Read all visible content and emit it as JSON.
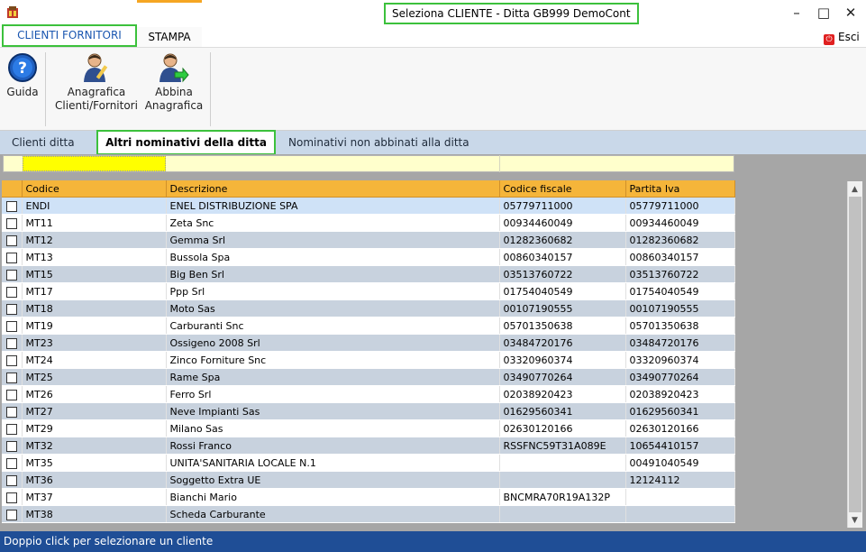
{
  "window": {
    "title": "Seleziona CLIENTE  - Ditta GB999 DemoCont",
    "minimize": "–",
    "maximize": "□",
    "close": "✕"
  },
  "ribbon": {
    "tabs": [
      {
        "label": "CLIENTI FORNITORI",
        "active": true
      },
      {
        "label": "STAMPA",
        "active": false
      }
    ],
    "exit_label": "Esci"
  },
  "toolbar": {
    "guida_label": "Guida",
    "anagrafica_line1": "Anagrafica",
    "anagrafica_line2": "Clienti/Fornitori",
    "abbina_line1": "Abbina",
    "abbina_line2": "Anagrafica"
  },
  "subtabs": [
    {
      "label": "Clienti ditta"
    },
    {
      "label": "Altri nominativi della ditta",
      "active": true
    },
    {
      "label": "Nominativi non abbinati alla ditta"
    }
  ],
  "filter": {
    "value": ""
  },
  "table": {
    "columns": [
      "Codice",
      "Descrizione",
      "Codice fiscale",
      "Partita Iva"
    ],
    "rows": [
      {
        "codice": "ENDI",
        "descrizione": "ENEL DISTRIBUZIONE SPA",
        "cf": "05779711000",
        "piva": "05779711000"
      },
      {
        "codice": "MT11",
        "descrizione": "Zeta Snc",
        "cf": "00934460049",
        "piva": "00934460049"
      },
      {
        "codice": "MT12",
        "descrizione": "Gemma Srl",
        "cf": "01282360682",
        "piva": "01282360682"
      },
      {
        "codice": "MT13",
        "descrizione": "Bussola Spa",
        "cf": "00860340157",
        "piva": "00860340157"
      },
      {
        "codice": "MT15",
        "descrizione": "Big Ben Srl",
        "cf": "03513760722",
        "piva": "03513760722"
      },
      {
        "codice": "MT17",
        "descrizione": "Ppp Srl",
        "cf": "01754040549",
        "piva": "01754040549"
      },
      {
        "codice": "MT18",
        "descrizione": "Moto Sas",
        "cf": "00107190555",
        "piva": "00107190555"
      },
      {
        "codice": "MT19",
        "descrizione": "Carburanti Snc",
        "cf": "05701350638",
        "piva": "05701350638"
      },
      {
        "codice": "MT23",
        "descrizione": "Ossigeno 2008 Srl",
        "cf": "03484720176",
        "piva": "03484720176"
      },
      {
        "codice": "MT24",
        "descrizione": "Zinco Forniture Snc",
        "cf": "03320960374",
        "piva": "03320960374"
      },
      {
        "codice": "MT25",
        "descrizione": "Rame Spa",
        "cf": "03490770264",
        "piva": "03490770264"
      },
      {
        "codice": "MT26",
        "descrizione": "Ferro Srl",
        "cf": "02038920423",
        "piva": "02038920423"
      },
      {
        "codice": "MT27",
        "descrizione": "Neve Impianti Sas",
        "cf": "01629560341",
        "piva": "01629560341"
      },
      {
        "codice": "MT29",
        "descrizione": "Milano Sas",
        "cf": "02630120166",
        "piva": "02630120166"
      },
      {
        "codice": "MT32",
        "descrizione": "Rossi Franco",
        "cf": "RSSFNC59T31A089E",
        "piva": "10654410157"
      },
      {
        "codice": "MT35",
        "descrizione": "UNITA'SANITARIA LOCALE N.1",
        "cf": "",
        "piva": "00491040549"
      },
      {
        "codice": "MT36",
        "descrizione": "Soggetto Extra UE",
        "cf": "",
        "piva": "12124112"
      },
      {
        "codice": "MT37",
        "descrizione": "Bianchi Mario",
        "cf": "BNCMRA70R19A132P",
        "piva": ""
      },
      {
        "codice": "MT38",
        "descrizione": "Scheda Carburante",
        "cf": "",
        "piva": ""
      }
    ]
  },
  "status": {
    "text": "Doppio click per selezionare un cliente"
  },
  "colors": {
    "highlight_box": "#3cc13c",
    "header_orange": "#f5b53a",
    "status_bar": "#1f4e96",
    "filter_yellow": "#ffff00"
  }
}
